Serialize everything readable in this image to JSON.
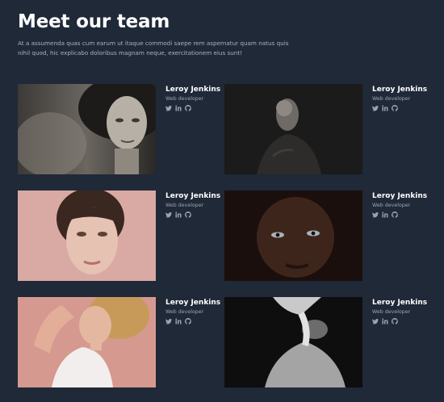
{
  "header": {
    "title": "Meet our team",
    "description": "At a assumenda quas cum earum ut itaque commodi saepe rem aspernatur quam natus quis nihil quod, hic explicabo doloribus magnam neque, exercitationem eius sunt!"
  },
  "members": [
    {
      "name": "Leroy Jenkins",
      "role": "Web developer"
    },
    {
      "name": "Leroy Jenkins",
      "role": "Web developer"
    },
    {
      "name": "Leroy Jenkins",
      "role": "Web developer"
    },
    {
      "name": "Leroy Jenkins",
      "role": "Web developer"
    },
    {
      "name": "Leroy Jenkins",
      "role": "Web developer"
    },
    {
      "name": "Leroy Jenkins",
      "role": "Web developer"
    }
  ],
  "social_icons": [
    "twitter-icon",
    "linkedin-icon",
    "github-icon"
  ],
  "colors": {
    "background": "#1f2937",
    "heading": "#ffffff",
    "muted_text": "#9aa3b2",
    "icon": "#9aa3b2"
  }
}
